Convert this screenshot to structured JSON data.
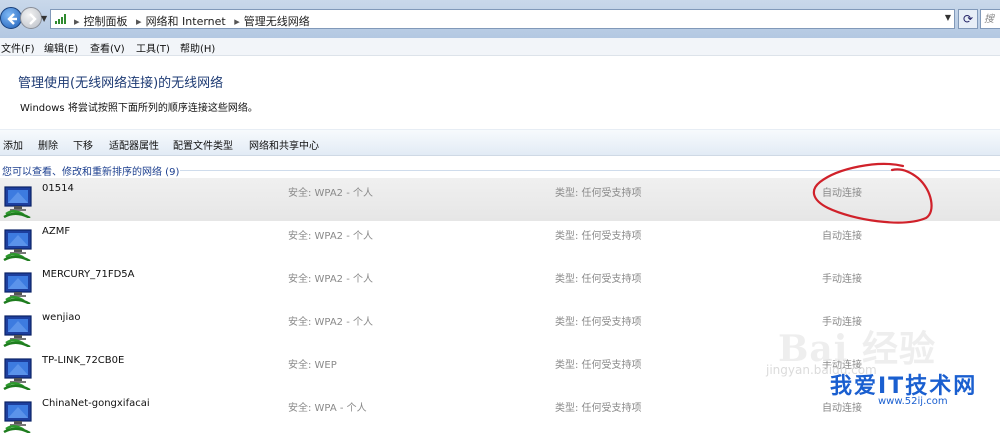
{
  "address_bar": {
    "breadcrumbs": [
      "控制面板",
      "网络和 Internet",
      "管理无线网络"
    ],
    "search_placeholder": "搜"
  },
  "menu": [
    {
      "label": "文件(F)"
    },
    {
      "label": "编辑(E)"
    },
    {
      "label": "查看(V)"
    },
    {
      "label": "工具(T)"
    },
    {
      "label": "帮助(H)"
    }
  ],
  "header": {
    "title": "管理使用(无线网络连接)的无线网络",
    "subtitle": "Windows 将尝试按照下面所列的顺序连接这些网络。"
  },
  "commands": [
    {
      "label": "添加"
    },
    {
      "label": "删除"
    },
    {
      "label": "下移"
    },
    {
      "label": "适配器属性"
    },
    {
      "label": "配置文件类型"
    },
    {
      "label": "网络和共享中心"
    }
  ],
  "group_header": "您可以查看、修改和重新排序的网络 (9)",
  "networks": [
    {
      "name": "01514",
      "security": "安全: WPA2 - 个人",
      "type": "类型: 任何受支持项",
      "connection": "自动连接",
      "selected": true
    },
    {
      "name": "AZMF",
      "security": "安全: WPA2 - 个人",
      "type": "类型: 任何受支持项",
      "connection": "自动连接",
      "selected": false
    },
    {
      "name": "MERCURY_71FD5A",
      "security": "安全: WPA2 - 个人",
      "type": "类型: 任何受支持项",
      "connection": "手动连接",
      "selected": false
    },
    {
      "name": "wenjiao",
      "security": "安全: WPA2 - 个人",
      "type": "类型: 任何受支持项",
      "connection": "手动连接",
      "selected": false
    },
    {
      "name": "TP-LINK_72CB0E",
      "security": "安全: WEP",
      "type": "类型: 任何受支持项",
      "connection": "手动连接",
      "selected": false
    },
    {
      "name": "ChinaNet-gongxifacai",
      "security": "安全: WPA - 个人",
      "type": "类型: 任何受支持项",
      "connection": "自动连接",
      "selected": false
    }
  ],
  "watermark": {
    "brand": "Bai 经验",
    "url1": "jingyan.baidu.com",
    "site": "我爱IT技术网",
    "url2": "www.52ij.com"
  },
  "colors": {
    "title": "#1e3b74",
    "group_header": "#1c3f8f",
    "annotation": "#d0212a",
    "watermark_site": "#1a5fd0"
  },
  "icons": {
    "network": "wireless-network-monitor-icon",
    "back": "back-arrow-icon",
    "forward": "forward-arrow-icon",
    "refresh": "refresh-icon"
  }
}
